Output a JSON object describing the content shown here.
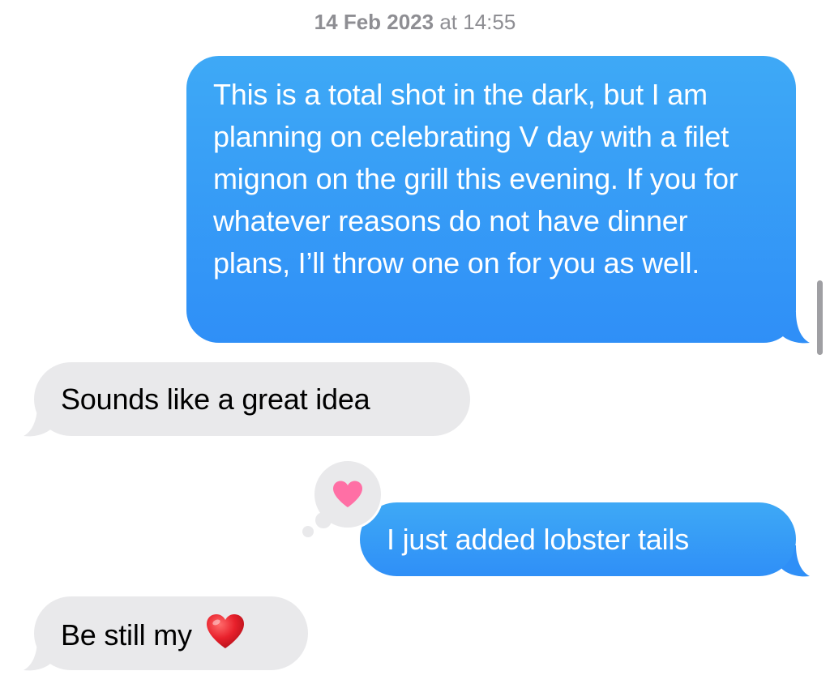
{
  "conversation": {
    "timestamp": {
      "date": "14 Feb 2023",
      "time": "at 14:55"
    },
    "messages": [
      {
        "direction": "sent",
        "text": "This is a total shot in the dark, but I am planning on celebrating V day with a filet mignon on the grill this evening. If you for whatever reasons do not have dinner plans, I’ll throw one on for you as well."
      },
      {
        "direction": "received",
        "text": "Sounds like a great idea"
      },
      {
        "direction": "sent",
        "text": "I just added lobster tails",
        "tapback": "heart-icon"
      },
      {
        "direction": "received",
        "text": "Be still my",
        "emoji": "red-heart-icon"
      }
    ]
  },
  "colors": {
    "sent_bubble": "#2f8ff7",
    "received_bubble": "#e9e9eb",
    "tapback_heart": "#ff6fa5",
    "emoji_heart": "#e8202b",
    "timestamp_text": "#8e8e93"
  }
}
